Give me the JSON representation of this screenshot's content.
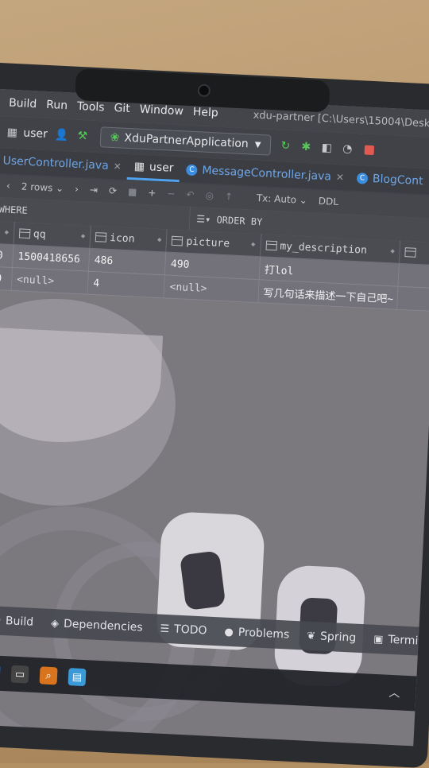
{
  "menu": {
    "items": [
      "Build",
      "Run",
      "Tools",
      "Git",
      "Window",
      "Help"
    ],
    "window_title": "xdu-partner [C:\\Users\\15004\\Desktop\\"
  },
  "toolbar": {
    "table_label": "user",
    "run_config": "XduPartnerApplication"
  },
  "tabs": [
    {
      "label": "UserController.java",
      "active": false
    },
    {
      "label": "user",
      "active": true
    },
    {
      "label": "MessageController.java",
      "active": false
    },
    {
      "label": "BlogCont",
      "active": false
    }
  ],
  "grid_toolbar": {
    "rows_label": "2 rows",
    "tx_label": "Tx: Auto",
    "ddl_label": "DDL"
  },
  "filter": {
    "where_label": "WHERE",
    "order_label": "ORDER BY"
  },
  "table": {
    "columns": [
      "qq",
      "icon",
      "picture",
      "my_description"
    ],
    "rows": [
      {
        "qq": "1500418656",
        "icon": "486",
        "picture": "490",
        "my_description": "打lol"
      },
      {
        "qq": "<null>",
        "icon": "4",
        "picture": "<null>",
        "my_description": "写几句话来描述一下自己吧~"
      }
    ]
  },
  "bottom_tools": [
    "Build",
    "Dependencies",
    "TODO",
    "Problems",
    "Spring",
    "Termi"
  ],
  "colors": {
    "accent": "#4fa2ee",
    "run_green": "#58c75a",
    "stop_red": "#e05a52",
    "tab_link": "#6ea6e6"
  },
  "icons": {
    "table": "table-icon",
    "run": "run-icon",
    "debug": "debug-icon",
    "stop": "stop-icon"
  }
}
